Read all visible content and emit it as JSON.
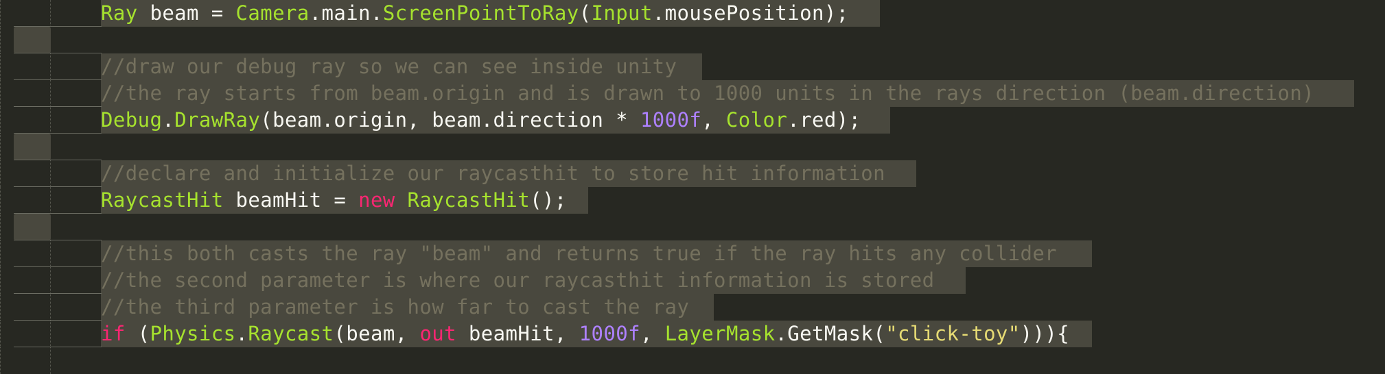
{
  "editor": {
    "theme_colors": {
      "background": "#272822",
      "selection": "#49483e",
      "type": "#a6e22e",
      "plain": "#f8f8f2",
      "comment": "#75715e",
      "keyword": "#f92672",
      "number": "#ae81ff",
      "string": "#e6db74"
    },
    "lines": [
      {
        "tokens": [
          {
            "t": "Ray",
            "c": "type"
          },
          {
            "t": " beam = ",
            "c": "plain"
          },
          {
            "t": "Camera",
            "c": "type"
          },
          {
            "t": ".main.",
            "c": "plain"
          },
          {
            "t": "ScreenPointToRay",
            "c": "type"
          },
          {
            "t": "(",
            "c": "plain"
          },
          {
            "t": "Input",
            "c": "type"
          },
          {
            "t": ".mousePosition);",
            "c": "plain"
          }
        ]
      },
      {
        "tokens": []
      },
      {
        "tokens": [
          {
            "t": "//draw our debug ray so we can see inside unity",
            "c": "comment"
          }
        ]
      },
      {
        "tokens": [
          {
            "t": "//the ray starts from beam.origin and is drawn to 1000 units in the rays direction (beam.direction)",
            "c": "comment"
          }
        ]
      },
      {
        "tokens": [
          {
            "t": "Debug",
            "c": "type"
          },
          {
            "t": ".",
            "c": "plain"
          },
          {
            "t": "DrawRay",
            "c": "type"
          },
          {
            "t": "(beam.origin, beam.direction * ",
            "c": "plain"
          },
          {
            "t": "1000f",
            "c": "number"
          },
          {
            "t": ", ",
            "c": "plain"
          },
          {
            "t": "Color",
            "c": "type"
          },
          {
            "t": ".red);",
            "c": "plain"
          }
        ]
      },
      {
        "tokens": []
      },
      {
        "tokens": [
          {
            "t": "//declare and initialize our raycasthit to store hit information",
            "c": "comment"
          }
        ]
      },
      {
        "tokens": [
          {
            "t": "RaycastHit",
            "c": "type"
          },
          {
            "t": " beamHit = ",
            "c": "plain"
          },
          {
            "t": "new",
            "c": "keyword"
          },
          {
            "t": " ",
            "c": "plain"
          },
          {
            "t": "RaycastHit",
            "c": "type"
          },
          {
            "t": "();",
            "c": "plain"
          }
        ]
      },
      {
        "tokens": []
      },
      {
        "tokens": [
          {
            "t": "//this both casts the ray \"beam\" and returns true if the ray hits any collider",
            "c": "comment"
          }
        ]
      },
      {
        "tokens": [
          {
            "t": "//the second parameter is where our raycasthit information is stored",
            "c": "comment"
          }
        ]
      },
      {
        "tokens": [
          {
            "t": "//the third parameter is how far to cast the ray",
            "c": "comment"
          }
        ]
      },
      {
        "tokens": [
          {
            "t": "if",
            "c": "keyword"
          },
          {
            "t": " (",
            "c": "plain"
          },
          {
            "t": "Physics",
            "c": "type"
          },
          {
            "t": ".",
            "c": "plain"
          },
          {
            "t": "Raycast",
            "c": "type"
          },
          {
            "t": "(beam, ",
            "c": "plain"
          },
          {
            "t": "out",
            "c": "keyword"
          },
          {
            "t": " beamHit, ",
            "c": "plain"
          },
          {
            "t": "1000f",
            "c": "number"
          },
          {
            "t": ", ",
            "c": "plain"
          },
          {
            "t": "LayerMask",
            "c": "type"
          },
          {
            "t": ".GetMask(",
            "c": "plain"
          },
          {
            "t": "\"click-toy\"",
            "c": "string"
          },
          {
            "t": "))){",
            "c": "plain"
          }
        ]
      }
    ]
  }
}
